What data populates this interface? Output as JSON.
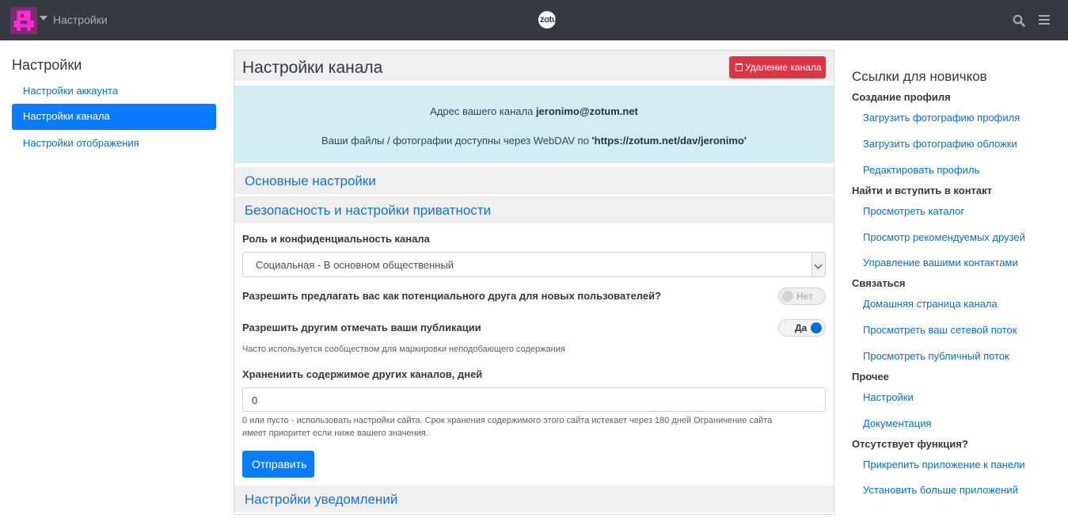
{
  "navbar": {
    "title": "Настройки",
    "brand": "zotum",
    "avatar_icon": "pixel-avatar-icon",
    "search_icon": "search-icon",
    "menu_icon": "hamburger-icon"
  },
  "left_sidebar": {
    "title": "Настройки",
    "items": [
      {
        "label": "Настройки аккаунта",
        "active": false
      },
      {
        "label": "Настройки канала",
        "active": true
      },
      {
        "label": "Настройки отображения",
        "active": false
      }
    ]
  },
  "main": {
    "title": "Настройки канала",
    "delete_button": "Удаление канала",
    "info": {
      "address_prefix": "Адрес вашего канала",
      "address": "jeronimo@zotum.net",
      "webdav_prefix": "Ваши файлы / фотографии доступны через WebDAV по",
      "webdav_url": "'https://zotum.net/dav/jeronimo'"
    },
    "sections": {
      "basic": "Основные настройки",
      "privacy": "Безопасность и настройки приватности",
      "notifications": "Настройки уведомлений"
    },
    "role_label": "Роль и конфиденциальность канала",
    "role_value": "Социальная - В основном общественный",
    "suggest_label": "Разрешить предлагать вас как потенциального друга для новых пользователей?",
    "suggest_toggle": "Нет",
    "tag_label": "Разрешить другим отмечать ваши публикации",
    "tag_toggle": "Да",
    "tag_help": "Часто используется сообществом для маркировки неподобающего содержания",
    "expire_label": "Хранениить содержимое других каналов, дней",
    "expire_value": "0",
    "expire_help_1": "0 или пусто - использовать настройки сайта. Срок хранения содержимого этого сайта истекает через 180 дней Ограничение сайта",
    "expire_help_2": "имеет приоритет если ниже вашего значения.",
    "submit": "Отправить"
  },
  "right_sidebar": {
    "title": "Ссылки для новичков",
    "groups": [
      {
        "heading": "Создание профиля",
        "links": [
          "Загрузить фотографию профиля",
          "Загрузить фотографию обложки",
          "Редактировать профиль"
        ]
      },
      {
        "heading": "Найти и вступить в контакт",
        "links": [
          "Просмотреть каталог",
          "Просмотр рекомендуемых друзей",
          "Управление вашими контактами"
        ]
      },
      {
        "heading": "Связаться",
        "links": [
          "Домашняя страница канала",
          "Просмотреть ваш сетевой поток",
          "Просмотреть публичный поток"
        ]
      },
      {
        "heading": "Прочее",
        "links": [
          "Настройки",
          "Документация"
        ]
      },
      {
        "heading": "Отсутствует функция?",
        "links": [
          "Прикрепить приложение к панели",
          "Установить больше приложений"
        ]
      }
    ]
  },
  "colors": {
    "navbar": "#343a40",
    "primary": "#0a7cff",
    "danger": "#dc3545",
    "info_bg": "#d2ecf2",
    "link": "#0b6dd6"
  }
}
